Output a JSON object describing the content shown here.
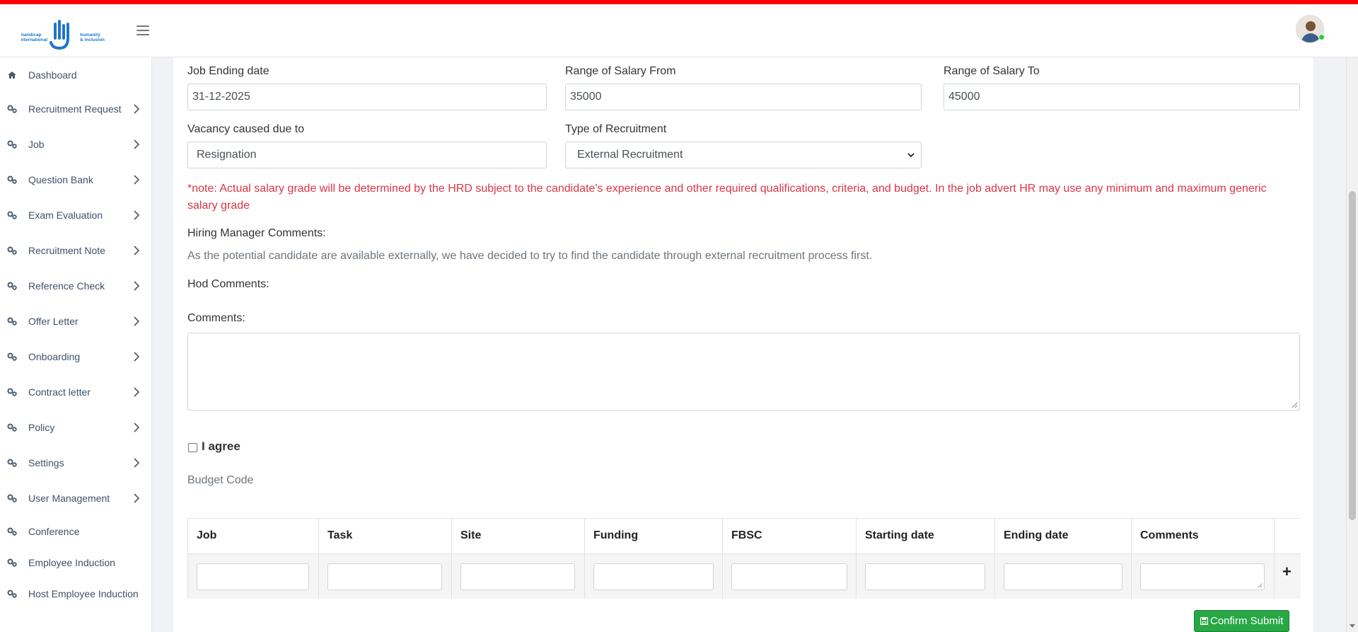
{
  "brand": {
    "logo_word_left": "handicap international",
    "logo_word_right": "humanity & inclusion",
    "colors": {
      "top_stripe": "#ff0000",
      "logo_blue": "#1f77c9",
      "danger": "#dc3545",
      "success": "#28a745"
    }
  },
  "sidebar": {
    "items": [
      {
        "label": "Dashboard",
        "icon": "home-icon",
        "has_submenu": false
      },
      {
        "label": "Recruitment Request",
        "icon": "cogs-icon",
        "has_submenu": true
      },
      {
        "label": "Job",
        "icon": "cogs-icon",
        "has_submenu": true
      },
      {
        "label": "Question Bank",
        "icon": "cogs-icon",
        "has_submenu": true
      },
      {
        "label": "Exam Evaluation",
        "icon": "cogs-icon",
        "has_submenu": true
      },
      {
        "label": "Recruitment Note",
        "icon": "cogs-icon",
        "has_submenu": true
      },
      {
        "label": "Reference Check",
        "icon": "cogs-icon",
        "has_submenu": true
      },
      {
        "label": "Offer Letter",
        "icon": "cogs-icon",
        "has_submenu": true
      },
      {
        "label": "Onboarding",
        "icon": "cogs-icon",
        "has_submenu": true
      },
      {
        "label": "Contract letter",
        "icon": "cogs-icon",
        "has_submenu": true
      },
      {
        "label": "Policy",
        "icon": "cogs-icon",
        "has_submenu": true
      },
      {
        "label": "Settings",
        "icon": "cogs-icon",
        "has_submenu": true
      },
      {
        "label": "User Management",
        "icon": "cogs-icon",
        "has_submenu": true
      },
      {
        "label": "Conference",
        "icon": "cogs-icon",
        "has_submenu": false
      },
      {
        "label": "Employee Induction",
        "icon": "cogs-icon",
        "has_submenu": false
      },
      {
        "label": "Host Employee Induction",
        "icon": "cogs-icon",
        "has_submenu": false
      }
    ]
  },
  "form": {
    "job_ending_date": {
      "label": "Job Ending date",
      "value": "31-12-2025"
    },
    "salary_from": {
      "label": "Range of Salary From",
      "value": "35000"
    },
    "salary_to": {
      "label": "Range of Salary To",
      "value": "45000"
    },
    "vacancy_cause": {
      "label": "Vacancy caused due to",
      "value": "Resignation"
    },
    "recruitment_type": {
      "label": "Type of Recruitment",
      "value": "External Recruitment"
    },
    "note": "*note: Actual salary grade will be determined by the HRD subject to the candidate's experience and other required qualifications, criteria, and budget. In the job advert HR may use any minimum and maximum generic salary grade",
    "hiring_manager_comments_label": "Hiring Manager Comments:",
    "hiring_manager_comments": "As the potential candidate are available externally, we have decided to try to find the candidate through external recruitment process first.",
    "hod_comments_label": "Hod Comments:",
    "comments_label": "Comments:",
    "comments_value": "",
    "agree_label": "I agree",
    "agree_checked": false,
    "budget_code_label": "Budget Code"
  },
  "budget_table": {
    "columns": [
      "Job",
      "Task",
      "Site",
      "Funding",
      "FBSC",
      "Starting date",
      "Ending date",
      "Comments"
    ],
    "rows": [
      [
        "",
        "",
        "",
        "",
        "",
        "",
        "",
        ""
      ]
    ],
    "add_row_symbol": "+"
  },
  "actions": {
    "confirm_submit": "Confirm Submit"
  }
}
